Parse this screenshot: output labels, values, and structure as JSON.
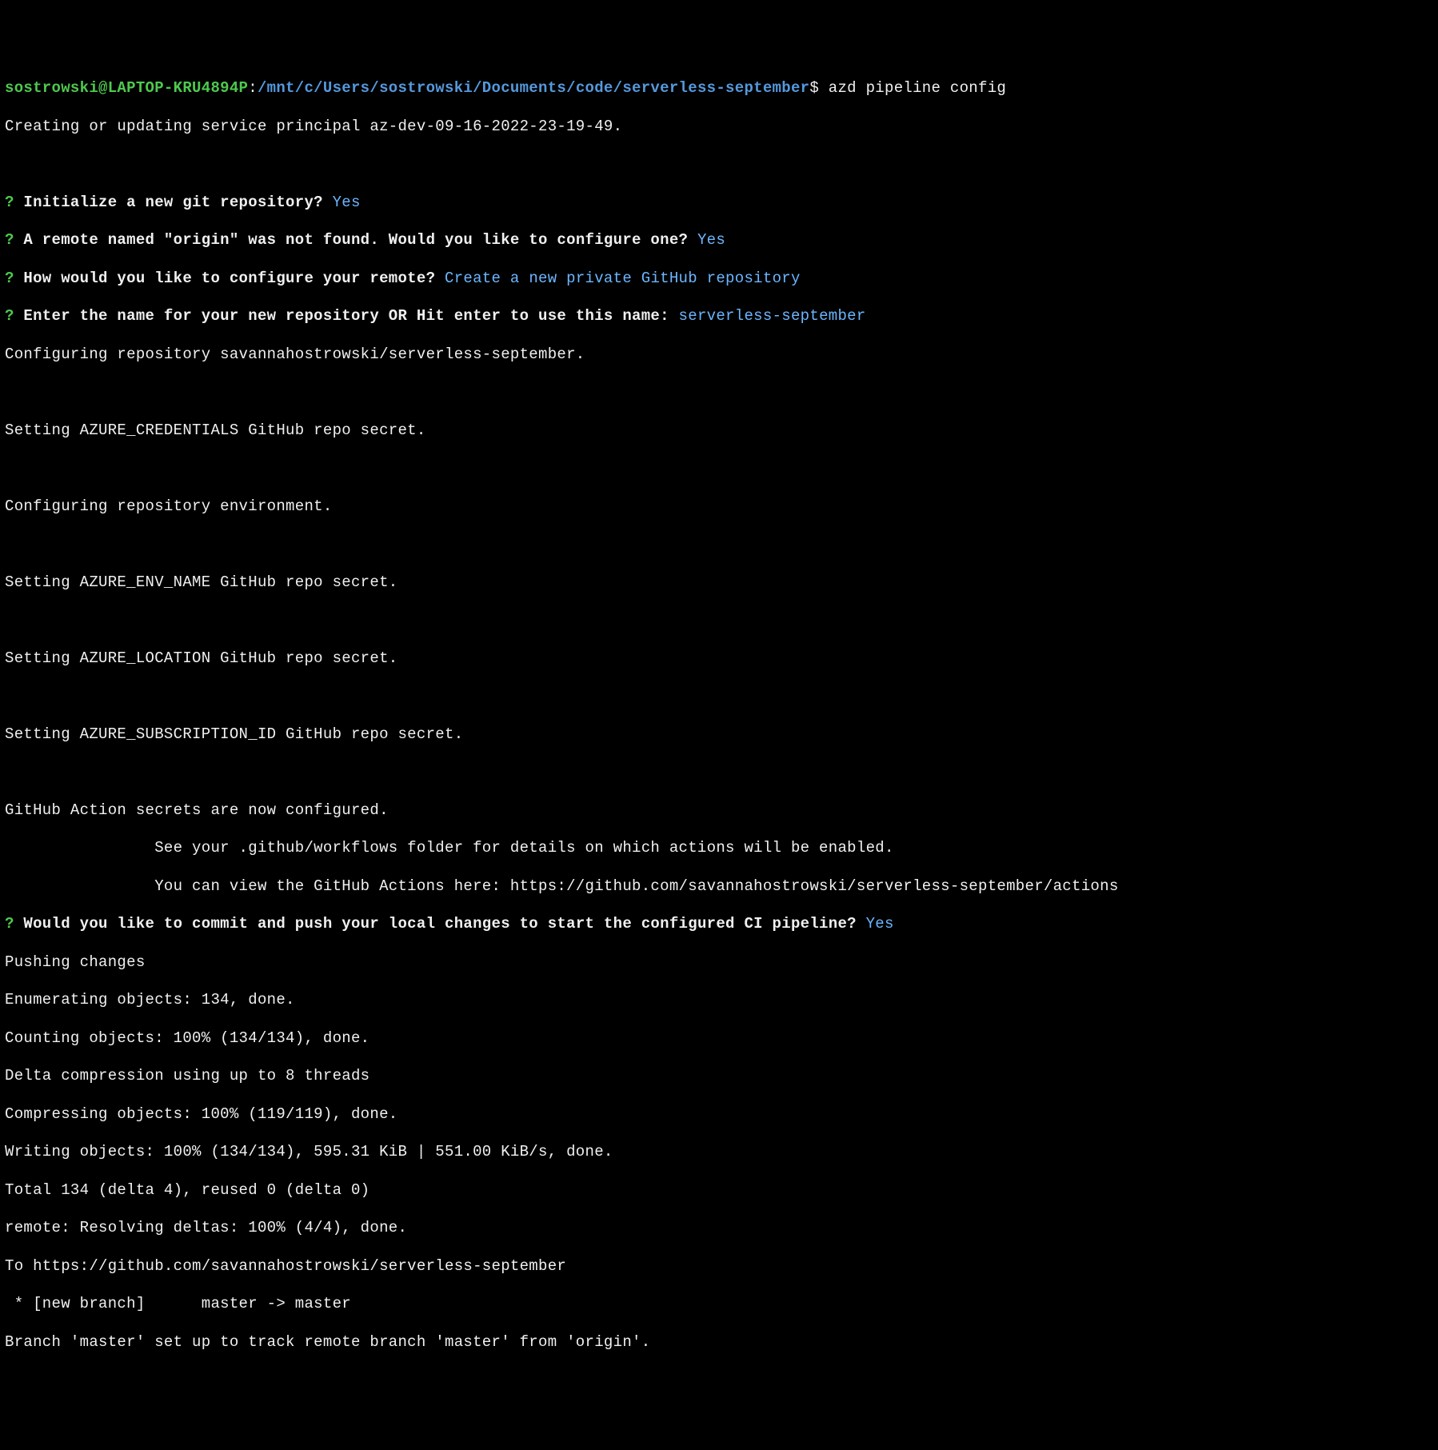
{
  "prompt": {
    "user_host": "sostrowski@LAPTOP-KRU4894P",
    "colon": ":",
    "path": "/mnt/c/Users/sostrowski/Documents/code/serverless-september",
    "dollar": "$ ",
    "command": "azd pipeline config"
  },
  "lines": {
    "l1": "Creating or updating service principal az-dev-09-16-2022-23-19-49.",
    "blank1": "",
    "q1_mark": "?",
    "q1_text": " Initialize a new git repository? ",
    "q1_ans": "Yes",
    "q2_mark": "?",
    "q2_text": " A remote named \"origin\" was not found. Would you like to configure one? ",
    "q2_ans": "Yes",
    "q3_mark": "?",
    "q3_text": " How would you like to configure your remote? ",
    "q3_ans": "Create a new private GitHub repository",
    "q4_mark": "?",
    "q4_text": " Enter the name for your new repository OR Hit enter to use this name: ",
    "q4_ans": "serverless-september",
    "l2": "Configuring repository savannahostrowski/serverless-september.",
    "blank2": "",
    "l3": "Setting AZURE_CREDENTIALS GitHub repo secret.",
    "blank3": "",
    "l4": "Configuring repository environment.",
    "blank4": "",
    "l5": "Setting AZURE_ENV_NAME GitHub repo secret.",
    "blank5": "",
    "l6": "Setting AZURE_LOCATION GitHub repo secret.",
    "blank6": "",
    "l7": "Setting AZURE_SUBSCRIPTION_ID GitHub repo secret.",
    "blank7": "",
    "l8": "GitHub Action secrets are now configured.",
    "l9": "                See your .github/workflows folder for details on which actions will be enabled.",
    "l10": "                You can view the GitHub Actions here: https://github.com/savannahostrowski/serverless-september/actions",
    "q5_mark": "?",
    "q5_text": " Would you like to commit and push your local changes to start the configured CI pipeline? ",
    "q5_ans": "Yes",
    "l11": "Pushing changes",
    "l12": "Enumerating objects: 134, done.",
    "l13": "Counting objects: 100% (134/134), done.",
    "l14": "Delta compression using up to 8 threads",
    "l15": "Compressing objects: 100% (119/119), done.",
    "l16": "Writing objects: 100% (134/134), 595.31 KiB | 551.00 KiB/s, done.",
    "l17": "Total 134 (delta 4), reused 0 (delta 0)",
    "l18": "remote: Resolving deltas: 100% (4/4), done.",
    "l19": "To https://github.com/savannahostrowski/serverless-september",
    "l20": " * [new branch]      master -> master",
    "l21": "Branch 'master' set up to track remote branch 'master' from 'origin'."
  }
}
